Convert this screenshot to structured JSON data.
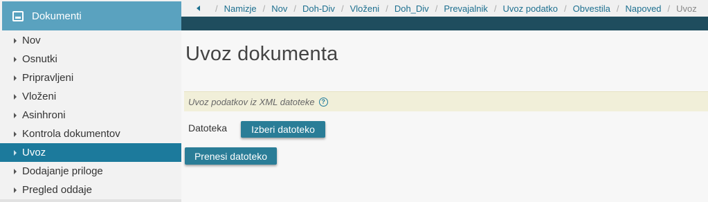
{
  "sidebar": {
    "title": "Dokumenti",
    "icon": "inbox-icon",
    "active_index": 6,
    "items": [
      {
        "label": "Nov"
      },
      {
        "label": "Osnutki"
      },
      {
        "label": "Pripravljeni"
      },
      {
        "label": "Vloženi"
      },
      {
        "label": "Asinhroni"
      },
      {
        "label": "Kontrola dokumentov"
      },
      {
        "label": "Uvoz"
      },
      {
        "label": "Dodajanje priloge"
      },
      {
        "label": "Pregled oddaje"
      }
    ]
  },
  "breadcrumb": {
    "items": [
      "Namizje",
      "Nov",
      "Doh-Div",
      "Vloženi",
      "Doh_Div",
      "Prevajalnik",
      "Uvoz podatko",
      "Obvestila",
      "Napoved"
    ],
    "current": "Uvoz"
  },
  "main": {
    "title": "Uvoz dokumenta",
    "info_text": "Uvoz podatkov iz XML datoteke",
    "help_symbol": "?",
    "file_label": "Datoteka",
    "select_button": "Izberi datoteko",
    "upload_button": "Prenesi datoteko"
  },
  "colors": {
    "sidebar_header": "#5aa2bf",
    "active_item": "#1c7a9c",
    "dark_bar": "#1f4d5e",
    "button": "#2a7d97",
    "info_bar": "#f1efd9"
  }
}
